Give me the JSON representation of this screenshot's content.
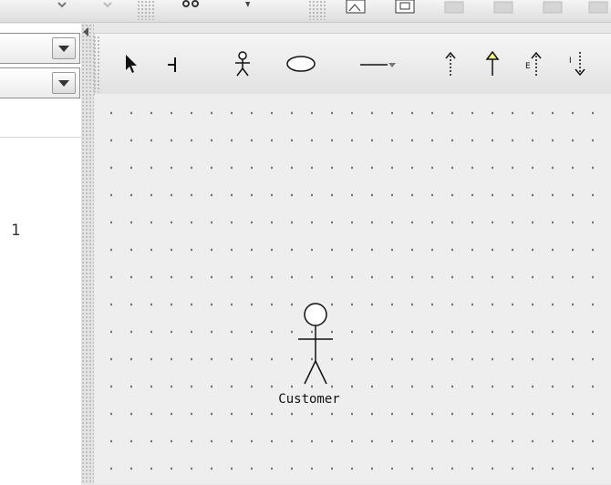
{
  "left_panel": {
    "number": "1"
  },
  "diagram_toolbar": {
    "tools": [
      {
        "name": "select-tool"
      },
      {
        "name": "anchor-tool"
      },
      {
        "name": "actor-tool"
      },
      {
        "name": "use-case-tool"
      },
      {
        "name": "line-tool"
      },
      {
        "name": "line-dropdown"
      },
      {
        "name": "dependency-arrow-tool"
      },
      {
        "name": "generalization-arrow-tool"
      },
      {
        "name": "extend-arrow-tool"
      },
      {
        "name": "include-arrow-tool"
      }
    ]
  },
  "canvas": {
    "actors": [
      {
        "label": "Customer"
      }
    ]
  },
  "colors": {
    "canvas_background": "#eeeeee",
    "grid_dot": "#6f6f6f",
    "generalization_arrow_fill": "#ffff80"
  }
}
